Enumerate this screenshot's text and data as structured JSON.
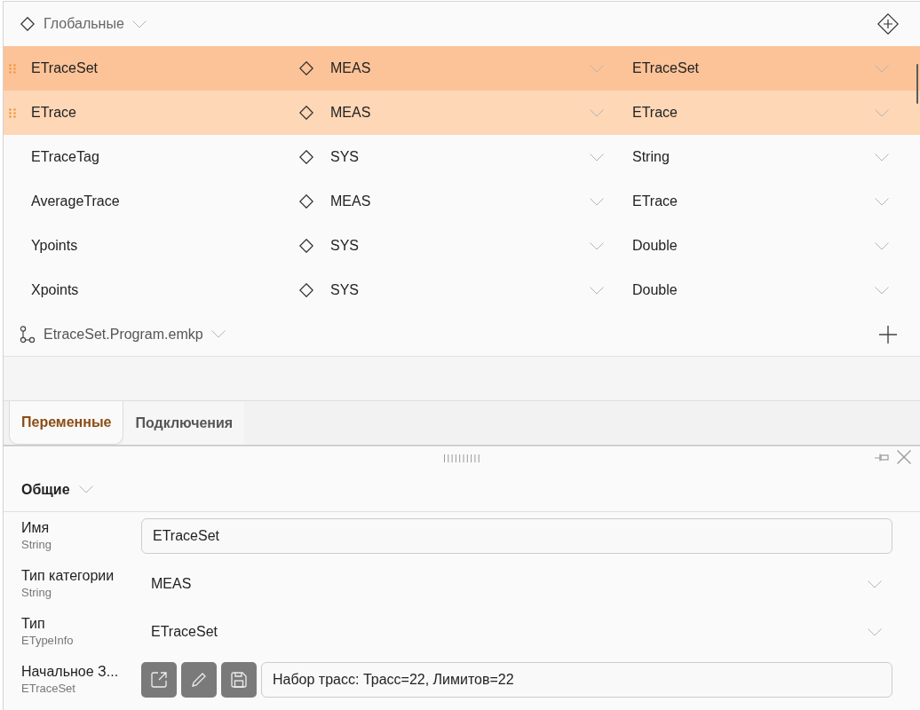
{
  "variables_section": {
    "header": {
      "label": "Глобальные"
    },
    "rows": [
      {
        "name": "ETraceSet",
        "category": "MEAS",
        "type": "ETraceSet",
        "selected": true,
        "current": true
      },
      {
        "name": "ETrace",
        "category": "MEAS",
        "type": "ETrace",
        "selected": true,
        "current": false
      },
      {
        "name": "ETraceTag",
        "category": "SYS",
        "type": "String",
        "selected": false,
        "current": false
      },
      {
        "name": "AverageTrace",
        "category": "MEAS",
        "type": "ETrace",
        "selected": false,
        "current": false
      },
      {
        "name": "Ypoints",
        "category": "SYS",
        "type": "Double",
        "selected": false,
        "current": false
      },
      {
        "name": "Xpoints",
        "category": "SYS",
        "type": "Double",
        "selected": false,
        "current": false
      }
    ]
  },
  "program": {
    "label": "EtraceSet.Program.emkp"
  },
  "tabs": [
    {
      "label": "Переменные",
      "selected": true
    },
    {
      "label": "Подключения",
      "selected": false
    }
  ],
  "properties": {
    "section": {
      "label": "Общие"
    },
    "rows": [
      {
        "kind": "text",
        "label": "Имя",
        "type": "String",
        "value": "ETraceSet"
      },
      {
        "kind": "dropdown",
        "label": "Тип категории",
        "type": "String",
        "value": "MEAS"
      },
      {
        "kind": "dropdown",
        "label": "Тип",
        "type": "ETypeInfo",
        "value": "ETraceSet"
      },
      {
        "kind": "object",
        "label": "Начальное З...",
        "type": "ETraceSet",
        "value": "Набор трасс: Трасс=22, Лимитов=22"
      }
    ]
  }
}
